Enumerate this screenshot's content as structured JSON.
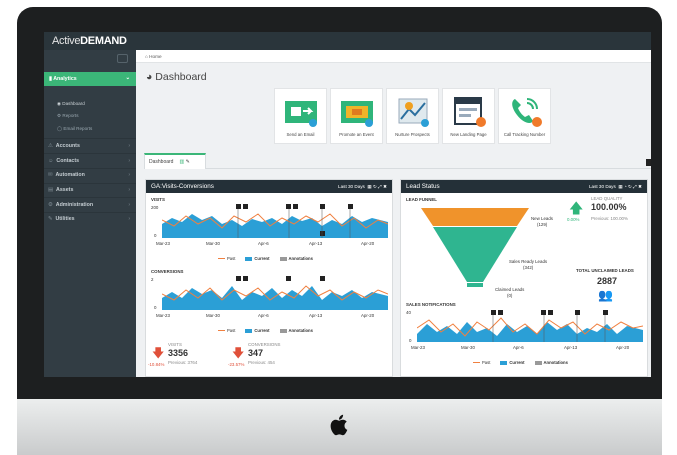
{
  "app": {
    "logo_light": "Active",
    "logo_bold": "DEMAND"
  },
  "breadcrumb": "Home",
  "page_title": "Dashboard",
  "sidebar": {
    "analytics": "Analytics",
    "sub": [
      "Dashboard",
      "Reports",
      "Email Reports"
    ],
    "items": [
      "Accounts",
      "Contacts",
      "Automation",
      "Assets",
      "Administration",
      "Utilities"
    ]
  },
  "tiles": [
    "Send an Email",
    "Promote an Event",
    "Nurture Prospects",
    "New Landing Page",
    "Call Tracking Number"
  ],
  "tab": "Dashboard",
  "ga_panel": {
    "title": "GA:Visits-Conversions",
    "range": "Last 30 Days",
    "visits_label": "VISITS",
    "conversions_label": "CONVERSIONS",
    "visits_y": [
      "200",
      "0"
    ],
    "conv_y": [
      "2",
      "0"
    ],
    "x_ticks": [
      "Mar-23",
      "Mar-30",
      "Apr-6",
      "Apr-13",
      "Apr-20"
    ],
    "legend": [
      "Past",
      "Current",
      "Annotations"
    ],
    "stat_visits": {
      "label": "VISITS",
      "value": "3356",
      "prev": "Previous: 3764",
      "change": "-10.84%"
    },
    "stat_conv": {
      "label": "CONVERSIONS",
      "value": "347",
      "prev": "Previous: 454",
      "change": "-23.57%"
    }
  },
  "lead_panel": {
    "title": "Lead Status",
    "range": "Last 30 Days",
    "funnel_label": "LEAD FUNNEL",
    "new_leads": "New Leads",
    "new_leads_n": "(129)",
    "sales_ready": "Sales Ready Leads",
    "sales_ready_n": "(342)",
    "claimed": "Claimed Leads",
    "claimed_n": "(0)",
    "quality_label": "LEAD QUALITY",
    "quality": "100.00%",
    "quality_change": "0.00%",
    "quality_prev": "Previous: 100.00%",
    "unclaimed_label": "TOTAL UNCLAIMED LEADS",
    "unclaimed": "2887",
    "notif_label": "SALES NOTIFICATIONS",
    "y_ticks": [
      "40",
      "0"
    ],
    "x_ticks": [
      "Mar-23",
      "Mar-30",
      "Apr-6",
      "Apr-13",
      "Apr-20"
    ],
    "legend": [
      "Past",
      "Current",
      "Annotations"
    ]
  },
  "colors": {
    "accent": "#3bb678",
    "chart_area": "#2b9fd6",
    "past_line": "#f08040",
    "funnel_top": "#f0932b",
    "funnel_bottom": "#2fb590"
  }
}
